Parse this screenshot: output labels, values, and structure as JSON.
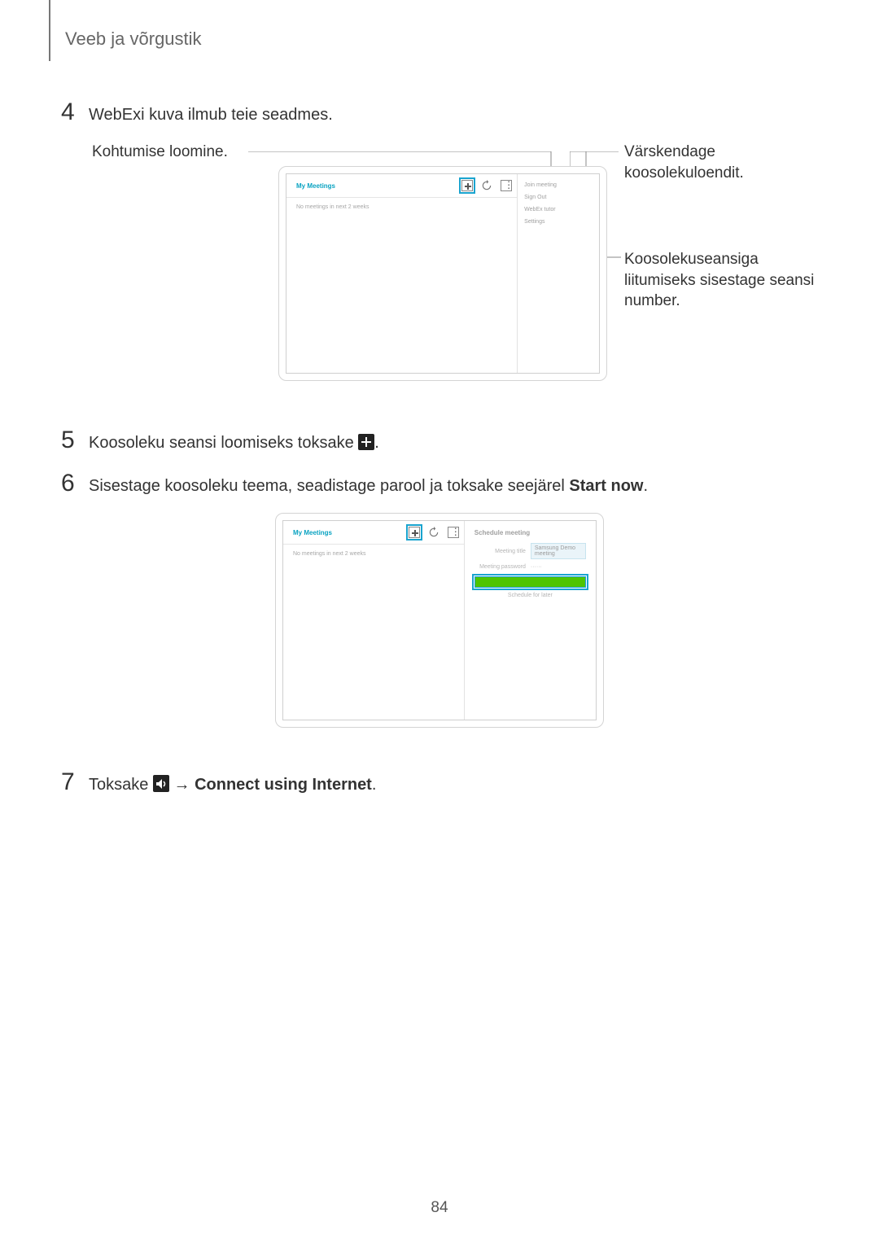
{
  "header": {
    "section_title": "Veeb ja võrgustik"
  },
  "steps": {
    "s4": {
      "num": "4",
      "text": "WebExi kuva ilmub teie seadmes."
    },
    "s5": {
      "num": "5",
      "text_pre": "Koosoleku seansi loomiseks toksake ",
      "text_post": "."
    },
    "s6": {
      "num": "6",
      "text_pre": "Sisestage koosoleku teema, seadistage parool ja toksake seejärel ",
      "bold": "Start now",
      "text_post": "."
    },
    "s7": {
      "num": "7",
      "text_pre": "Toksake ",
      "arrow": " → ",
      "bold": "Connect using Internet",
      "text_post": "."
    }
  },
  "callouts": {
    "left": "Kohtumise loomine.",
    "right_a": "Värskendage koosolekuloendit.",
    "right_b": "Koosolekuseansiga liitumiseks sisestage seansi number."
  },
  "screen1": {
    "title": "My Meetings",
    "empty": "No meetings in next 2 weeks",
    "right": {
      "item1": "Join meeting",
      "item2": "Sign Out",
      "item3": "WebEx tutor",
      "item4": "Settings"
    }
  },
  "screen2": {
    "title": "My Meetings",
    "empty": "No meetings in next 2 weeks",
    "form_header": "Schedule meeting",
    "row1": {
      "label": "Meeting title",
      "value": "Samsung Demo meeting"
    },
    "row2": {
      "label": "Meeting password",
      "value": "······"
    },
    "row3": {
      "label": "",
      "value": ""
    },
    "schedule": "Schedule for later"
  },
  "icons": {
    "plus": "plus-icon",
    "refresh": "refresh-icon",
    "more": "more-icon",
    "audio": "audio-icon"
  },
  "page_number": "84"
}
